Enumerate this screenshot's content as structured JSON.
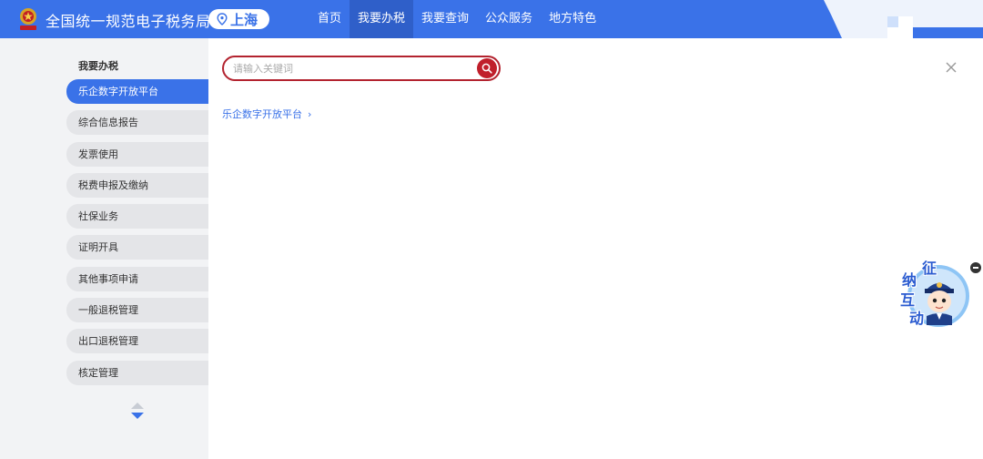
{
  "header": {
    "title": "全国统一规范电子税务局",
    "region": "上海",
    "nav": [
      "首页",
      "我要办税",
      "我要查询",
      "公众服务",
      "地方特色"
    ],
    "active_nav_index": 1
  },
  "sidebar": {
    "heading": "我要办税",
    "items": [
      {
        "label": "乐企数字开放平台",
        "active": true
      },
      {
        "label": "综合信息报告"
      },
      {
        "label": "发票使用"
      },
      {
        "label": "税费申报及缴纳"
      },
      {
        "label": "社保业务"
      },
      {
        "label": "证明开具"
      },
      {
        "label": "其他事项申请"
      },
      {
        "label": "一般退税管理"
      },
      {
        "label": "出口退税管理"
      },
      {
        "label": "核定管理"
      }
    ]
  },
  "main": {
    "search": {
      "placeholder": "请输入关键词",
      "value": ""
    },
    "result": "乐企数字开放平台",
    "result_chevron": "›"
  },
  "assistant": {
    "chars": [
      "征",
      "纳",
      "互",
      "动"
    ]
  },
  "colors": {
    "primary": "#3a72e8",
    "primary_dark": "#2f5fc9",
    "search_border": "#b3232f",
    "search_button": "#c01f2b",
    "sidebar_bg": "#f2f3f5",
    "sidebar_item_bg": "#e4e5e8"
  },
  "icons": {
    "logo": "tax-emblem-icon",
    "region": "location-pin-icon",
    "search": "search-icon",
    "close": "close-icon",
    "scroll": "scroll-arrows-icon",
    "assistant": "assistant-avatar-icon",
    "minimize": "minimize-icon"
  }
}
